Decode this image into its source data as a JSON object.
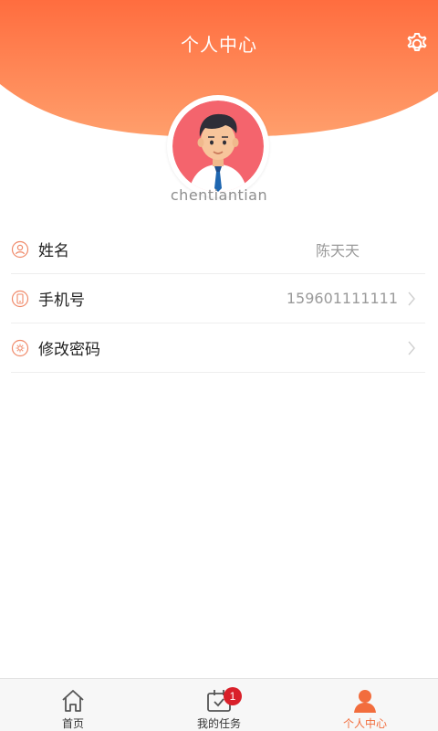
{
  "header": {
    "title": "个人中心",
    "settings_icon": "gear-icon",
    "gradient_top": "#ff7040",
    "gradient_bottom": "#ff9a66"
  },
  "profile": {
    "username": "chentiantian",
    "avatar_icon": "avatar-man-icon"
  },
  "info_list": [
    {
      "label": "姓名",
      "value": "陈天天",
      "icon": "user-circle-icon",
      "has_arrow": false
    },
    {
      "label": "手机号",
      "value": "159601111111",
      "icon": "phone-icon",
      "has_arrow": true
    },
    {
      "label": "修改密码",
      "value": "",
      "icon": "lock-gear-icon",
      "has_arrow": true
    }
  ],
  "tabbar": {
    "items": [
      {
        "label": "首页",
        "icon": "home-icon",
        "active": false
      },
      {
        "label": "我的任务",
        "icon": "calendar-check-icon",
        "active": false,
        "badge": "1"
      },
      {
        "label": "个人中心",
        "icon": "person-icon",
        "active": true
      }
    ],
    "active_color": "#f26d3d"
  }
}
